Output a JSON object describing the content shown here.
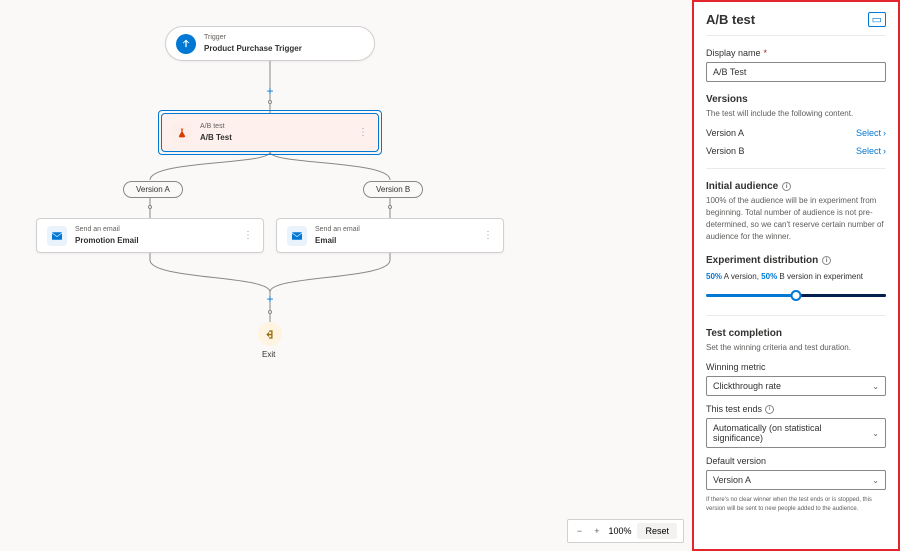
{
  "canvas": {
    "trigger": {
      "sub": "Trigger",
      "main": "Product Purchase Trigger"
    },
    "abtest": {
      "sub": "A/B test",
      "main": "A/B Test"
    },
    "branchA": {
      "label": "Version A"
    },
    "branchB": {
      "label": "Version B"
    },
    "emailA": {
      "sub": "Send an email",
      "main": "Promotion Email"
    },
    "emailB": {
      "sub": "Send an email",
      "main": "Email"
    },
    "exit": {
      "label": "Exit"
    },
    "zoom": {
      "level": "100%",
      "reset": "Reset"
    }
  },
  "panel": {
    "title": "A/B test",
    "display_name": {
      "label": "Display name",
      "value": "A/B Test"
    },
    "versions": {
      "title": "Versions",
      "desc": "The test will include the following content.",
      "a": "Version A",
      "b": "Version B",
      "select": "Select"
    },
    "audience": {
      "title": "Initial audience",
      "desc": "100% of the audience will be in experiment from beginning. Total number of audience is not pre-determined, so we can't reserve certain number of audience for the winner."
    },
    "distribution": {
      "title": "Experiment distribution",
      "pctA": "50%",
      "labelA": "A version,",
      "pctB": "50%",
      "labelB": "B version in experiment"
    },
    "completion": {
      "title": "Test completion",
      "desc": "Set the winning criteria and test duration.",
      "metric_label": "Winning metric",
      "metric_value": "Clickthrough rate",
      "ends_label": "This test ends",
      "ends_value": "Automatically (on statistical significance)",
      "default_label": "Default version",
      "default_value": "Version A",
      "fine_print": "If there's no clear winner when the test ends or is stopped, this version will be sent to new people added to the audience."
    }
  }
}
